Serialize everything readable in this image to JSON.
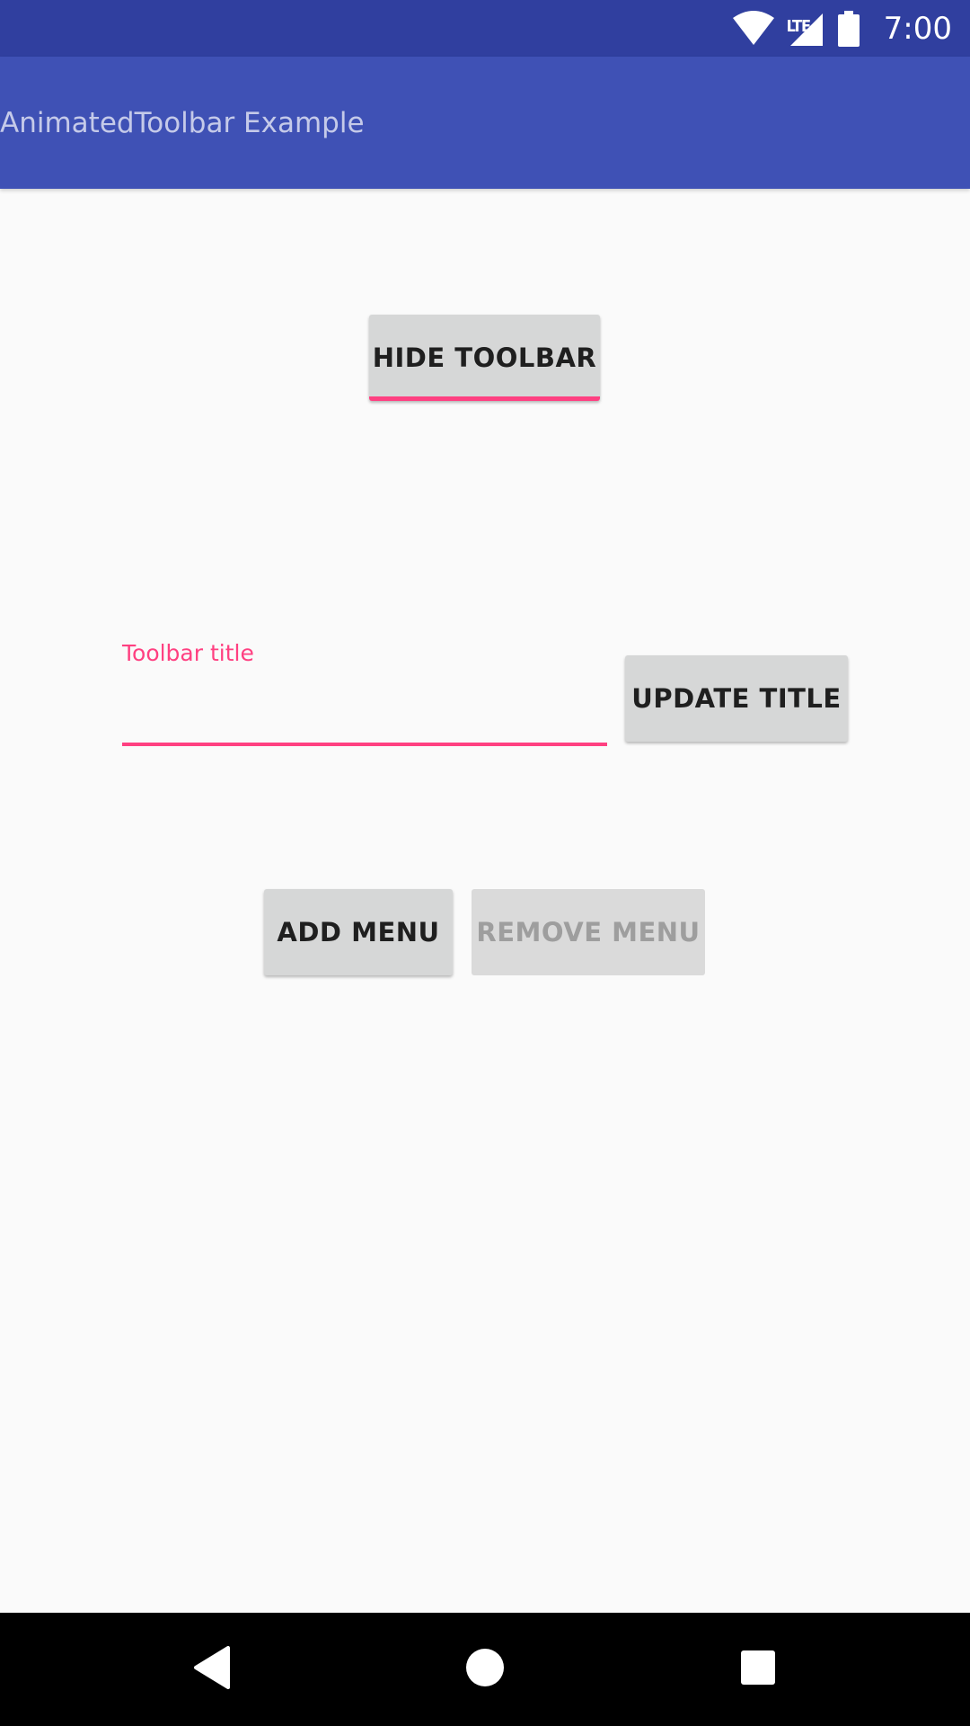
{
  "status_bar": {
    "network_label": "LTE",
    "time": "7:00",
    "icons": [
      "wifi-icon",
      "signal-icon",
      "battery-icon"
    ]
  },
  "app_bar": {
    "title": "AnimatedToolbar Example"
  },
  "main": {
    "hide_toolbar_label": "HIDE TOOLBAR",
    "title_field": {
      "label": "Toolbar title",
      "value": "",
      "placeholder": ""
    },
    "update_title_label": "UPDATE TITLE",
    "add_menu_label": "ADD MENU",
    "remove_menu_label": "REMOVE MENU"
  },
  "nav_bar": {
    "icons": [
      "back-icon",
      "home-icon",
      "recents-icon"
    ]
  },
  "colors": {
    "status_bar": "#303f9f",
    "primary": "#3f51b5",
    "accent": "#ff4081",
    "button": "#d6d7d7",
    "disabled_text": "#9e9e9e"
  }
}
